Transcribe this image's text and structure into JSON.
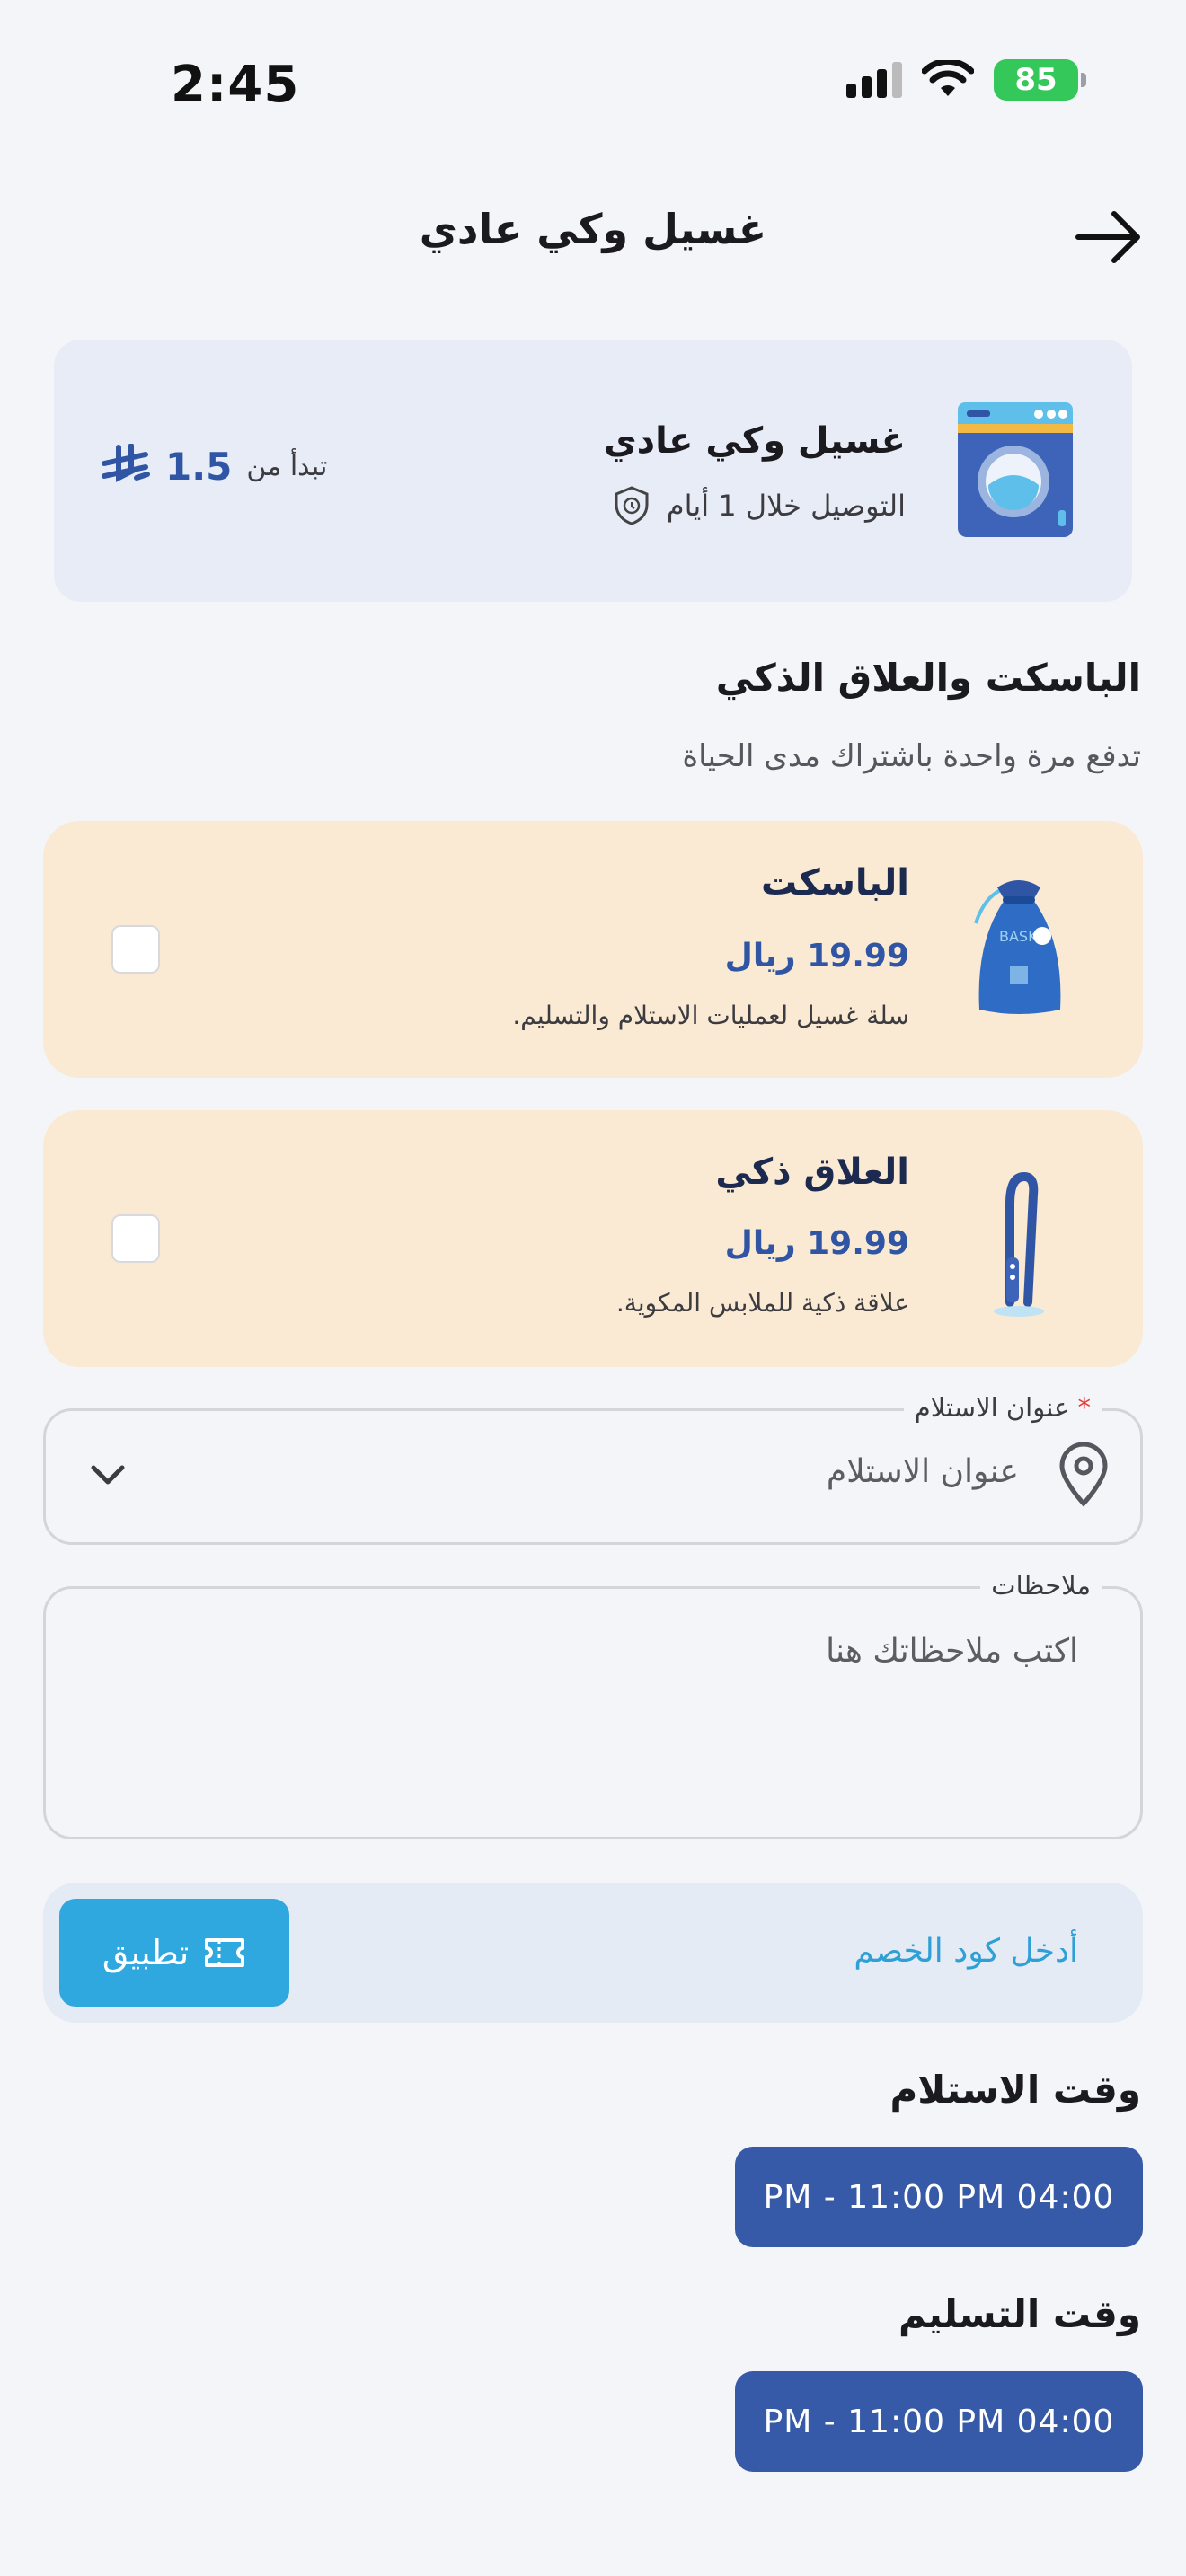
{
  "status_bar": {
    "time": "2:45",
    "battery": "85"
  },
  "header": {
    "title": "غسيل وكي عادي"
  },
  "service": {
    "name": "غسيل وكي عادي",
    "delivery": "التوصيل خلال 1 أيام",
    "price_prefix": "تبدأ من",
    "price": "1.5"
  },
  "section": {
    "title": "الباسكت والعلاق الذكي",
    "subtitle": "تدفع مرة واحدة باشتراك مدى الحياة"
  },
  "products": [
    {
      "title": "الباسكت",
      "price": "19.99 ريال",
      "desc": "سلة غسيل لعمليات الاستلام والتسليم."
    },
    {
      "title": "العلاق ذكي",
      "price": "19.99 ريال",
      "desc": "علاقة ذكية للملابس المكوية."
    }
  ],
  "address": {
    "label": "عنوان الاستلام",
    "required_mark": "*",
    "placeholder": "عنوان الاستلام"
  },
  "notes": {
    "label": "ملاحظات",
    "placeholder": "اكتب ملاحظاتك هنا"
  },
  "discount": {
    "placeholder": "أدخل كود الخصم",
    "apply_label": "تطبيق"
  },
  "pickup": {
    "title": "وقت الاستلام",
    "slot": "PM - 11:00 PM 04:00"
  },
  "delivery_time": {
    "title": "وقت التسليم",
    "slot": "PM - 11:00 PM 04:00"
  },
  "colors": {
    "primary": "#365aa7",
    "accent": "#2fa7df",
    "card_bg": "#faead3",
    "service_bg": "#e8ecf6"
  }
}
